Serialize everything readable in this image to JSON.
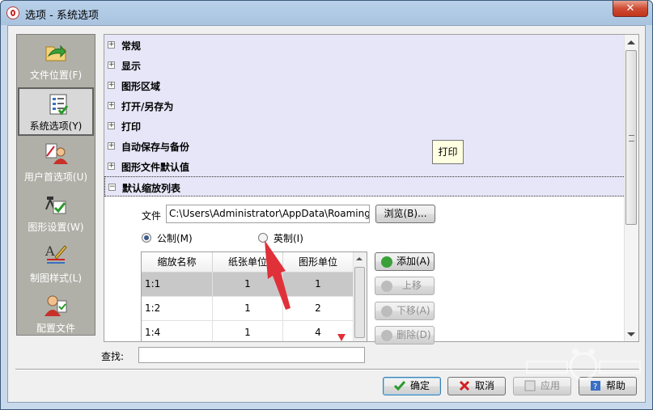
{
  "window": {
    "title": "选项 - 系统选项",
    "close_glyph": "✕"
  },
  "sidebar": {
    "items": [
      {
        "label": "文件位置(F)",
        "icon": "folder-arrow-icon",
        "selected": false
      },
      {
        "label": "系统选项(Y)",
        "icon": "list-check-icon",
        "selected": true
      },
      {
        "label": "用户首选项(U)",
        "icon": "user-tools-icon",
        "selected": false
      },
      {
        "label": "图形设置(W)",
        "icon": "graphics-settings-icon",
        "selected": false
      },
      {
        "label": "制图样式(L)",
        "icon": "drafting-style-icon",
        "selected": false
      },
      {
        "label": "配置文件",
        "icon": "profile-icon",
        "selected": false
      }
    ]
  },
  "tree": {
    "nodes": [
      {
        "label": "常规",
        "expander": "+"
      },
      {
        "label": "显示",
        "expander": "+"
      },
      {
        "label": "图形区域",
        "expander": "+"
      },
      {
        "label": "打开/另存为",
        "expander": "+"
      },
      {
        "label": "打印",
        "expander": "+"
      },
      {
        "label": "自动保存与备份",
        "expander": "+"
      },
      {
        "label": "图形文件默认值",
        "expander": "+"
      },
      {
        "label": "默认缩放列表",
        "expander": "−"
      }
    ],
    "tooltip": "打印"
  },
  "zoom_list": {
    "file_label": "文件",
    "file_path": "C:\\Users\\Administrator\\AppData\\Roaming\\",
    "browse_label": "浏览(B)...",
    "unit_metric_label": "公制(M)",
    "unit_imperial_label": "英制(I)",
    "selected_unit": "metric",
    "columns": [
      "缩放名称",
      "纸张单位",
      "图形单位"
    ],
    "rows": [
      {
        "name": "1:1",
        "paper": "1",
        "drawing": "1",
        "selected": true
      },
      {
        "name": "1:2",
        "paper": "1",
        "drawing": "2",
        "selected": false
      },
      {
        "name": "1:4",
        "paper": "1",
        "drawing": "4",
        "selected": false
      }
    ],
    "actions": {
      "add": "添加(A)",
      "move_up": "上移",
      "move_down": "下移(A)",
      "delete": "删除(D)"
    }
  },
  "find": {
    "label": "查找:",
    "value": ""
  },
  "footer": {
    "ok": "确定",
    "cancel": "取消",
    "apply": "应用",
    "help": "帮助"
  },
  "colors": {
    "tree_row_bg": "#e6e6f8",
    "annotation_arrow": "#e0303a",
    "accent_green": "#3aa03a"
  }
}
